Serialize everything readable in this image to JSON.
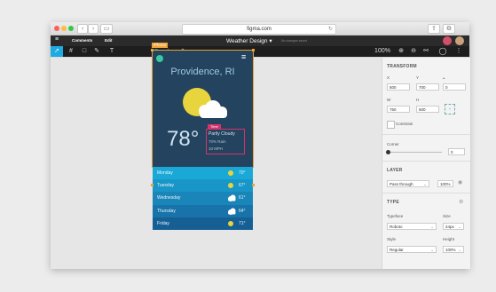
{
  "browser": {
    "url": "figma.com",
    "dot_colors": [
      "#fc605b",
      "#fdbc40",
      "#34c84a"
    ]
  },
  "menubar": {
    "tabs": [
      "Comments",
      "Edit"
    ],
    "document_title": "Weather Design",
    "document_caret": "▾",
    "sub_status": "No changes saved"
  },
  "toolbar": {
    "zoom": "100%",
    "accent": "#1cabe2"
  },
  "frame": {
    "label": "iPhone",
    "city": "Providence, RI",
    "temperature": "78°",
    "badge": "Time",
    "condition": "Partly Cloudy",
    "humidity": "70% Rain",
    "wind": "10 MPH",
    "accent_color": "#e9a236"
  },
  "forecast": [
    {
      "day": "Monday",
      "temp": "70°",
      "icon": "sun-icon",
      "color": "#1aa8d6"
    },
    {
      "day": "Tuesday",
      "temp": "67°",
      "icon": "sun-icon",
      "color": "#1996c8"
    },
    {
      "day": "Wednesday",
      "temp": "61°",
      "icon": "cloud-icon",
      "color": "#1985b9"
    },
    {
      "day": "Thursday",
      "temp": "64°",
      "icon": "cloud-icon",
      "color": "#1773a9"
    },
    {
      "day": "Friday",
      "temp": "71°",
      "icon": "sun-icon",
      "color": "#155f95"
    }
  ],
  "panel": {
    "transform": {
      "title": "TRANSFORM",
      "x_label": "X",
      "x_value": "500",
      "y_label": "Y",
      "y_value": "700",
      "r_label": "⦣",
      "r_value": "0",
      "w_label": "W",
      "w_value": "750",
      "h_label": "H",
      "h_value": "500",
      "constrain_label": "Constrain"
    },
    "corner": {
      "label": "Corner",
      "value": "0"
    },
    "layer": {
      "title": "LAYER",
      "blend": "Pass through",
      "opacity": "100%"
    },
    "type": {
      "title": "TYPE",
      "typeface_label": "Typeface",
      "typeface": "Roboto",
      "size_label": "Size",
      "size": "24px",
      "style_label": "Style",
      "style": "Regular",
      "height_label": "Height",
      "height": "100%"
    }
  }
}
